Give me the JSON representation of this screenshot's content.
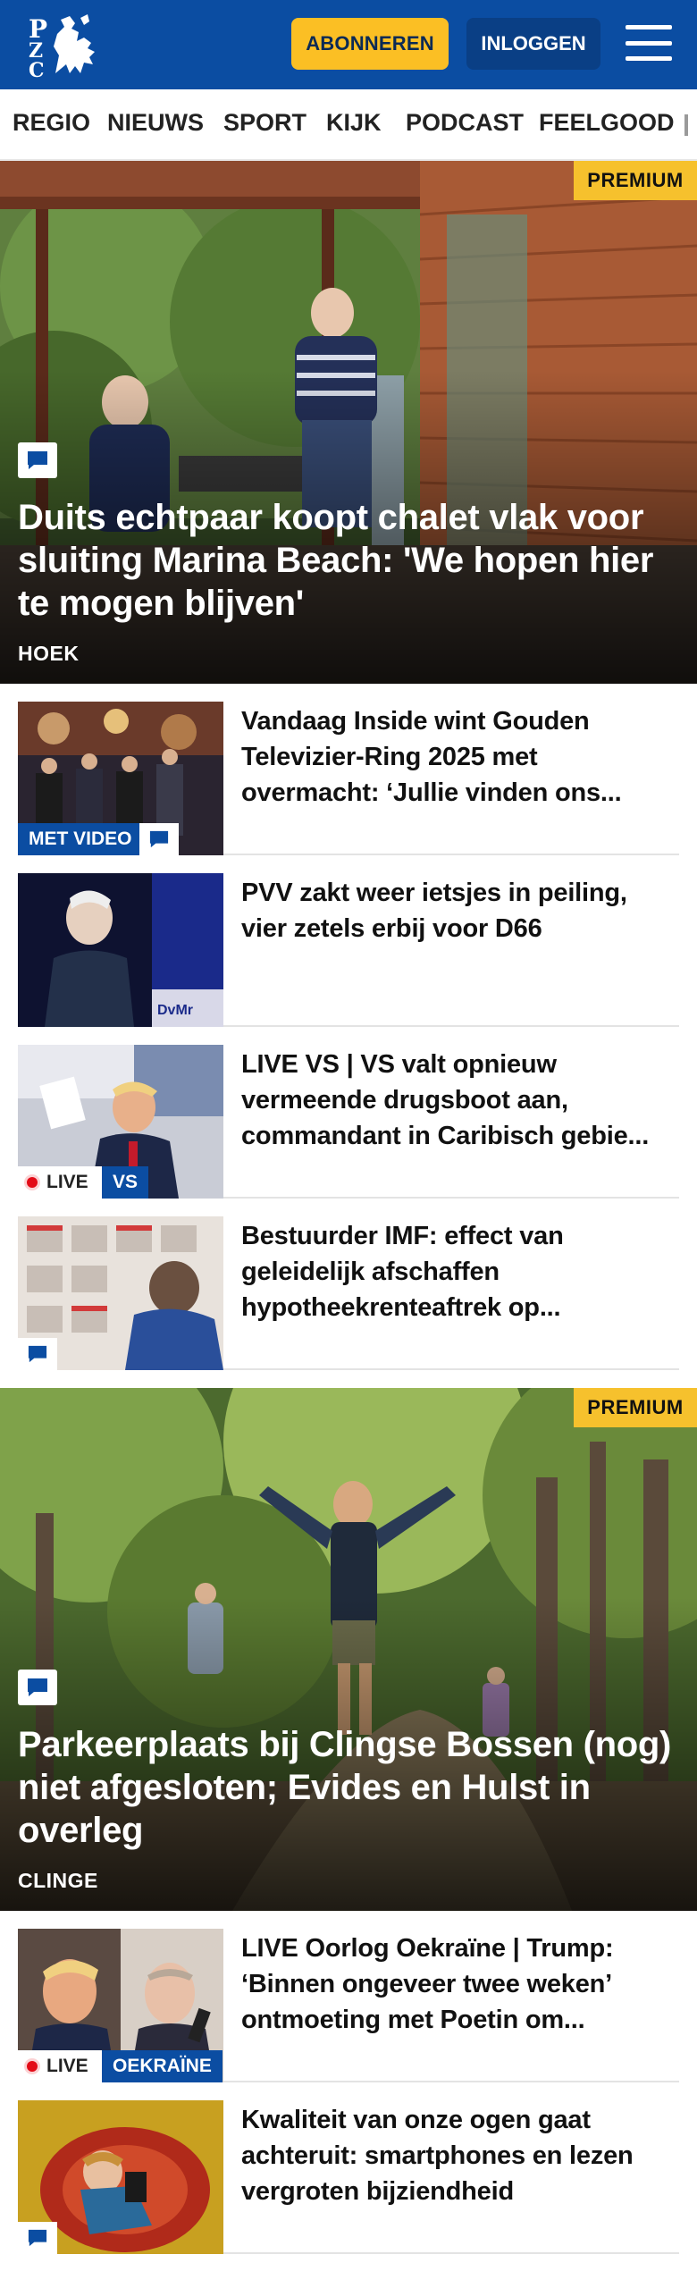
{
  "header": {
    "logo_letters": [
      "P",
      "Z",
      "C"
    ],
    "subscribe_label": "ABONNEREN",
    "login_label": "INLOGGEN",
    "brand_color": "#0b4da2",
    "accent_color": "#fbbf24"
  },
  "nav": {
    "items": [
      "REGIO",
      "NIEUWS",
      "SPORT",
      "KIJK",
      "PODCAST",
      "FEELGOOD"
    ]
  },
  "hero1": {
    "premium_label": "PREMIUM",
    "title": "Duits echtpaar koopt chalet vlak voor sluiting Marina Beach: 'We hopen hier te mogen blijven'",
    "tag": "HOEK",
    "icon": "comment-icon"
  },
  "articles": [
    {
      "title": "Vandaag Inside wint Gouden Televizier-Ring 2025 met overmacht: ‘Jullie vinden ons...",
      "video_label": "MET VIDEO",
      "icon": "comment-icon"
    },
    {
      "title": "PVV zakt weer ietsjes in peiling, vier zetels erbij voor D66"
    },
    {
      "title": "LIVE VS | VS valt opnieuw vermeende drugsboot aan, commandant in Caribisch gebie...",
      "live_label": "LIVE",
      "category_label": "VS"
    },
    {
      "title": "Bestuurder IMF: effect van geleidelijk afschaffen hypotheekrenteaftrek op...",
      "icon": "comment-icon"
    }
  ],
  "hero2": {
    "premium_label": "PREMIUM",
    "title": "Parkeerplaats bij Clingse Bossen (nog) niet afgesloten; Evides en Hulst in overleg",
    "tag": "CLINGE",
    "icon": "comment-icon"
  },
  "articles2": [
    {
      "title": "LIVE Oorlog Oekraïne | Trump: ‘Binnen ongeveer twee weken’ ontmoeting met Poetin om...",
      "live_label": "LIVE",
      "category_label": "OEKRAÏNE"
    },
    {
      "title": "Kwaliteit van onze ogen gaat achteruit: smartphones en lezen vergroten bijziendheid",
      "icon": "comment-icon"
    }
  ]
}
